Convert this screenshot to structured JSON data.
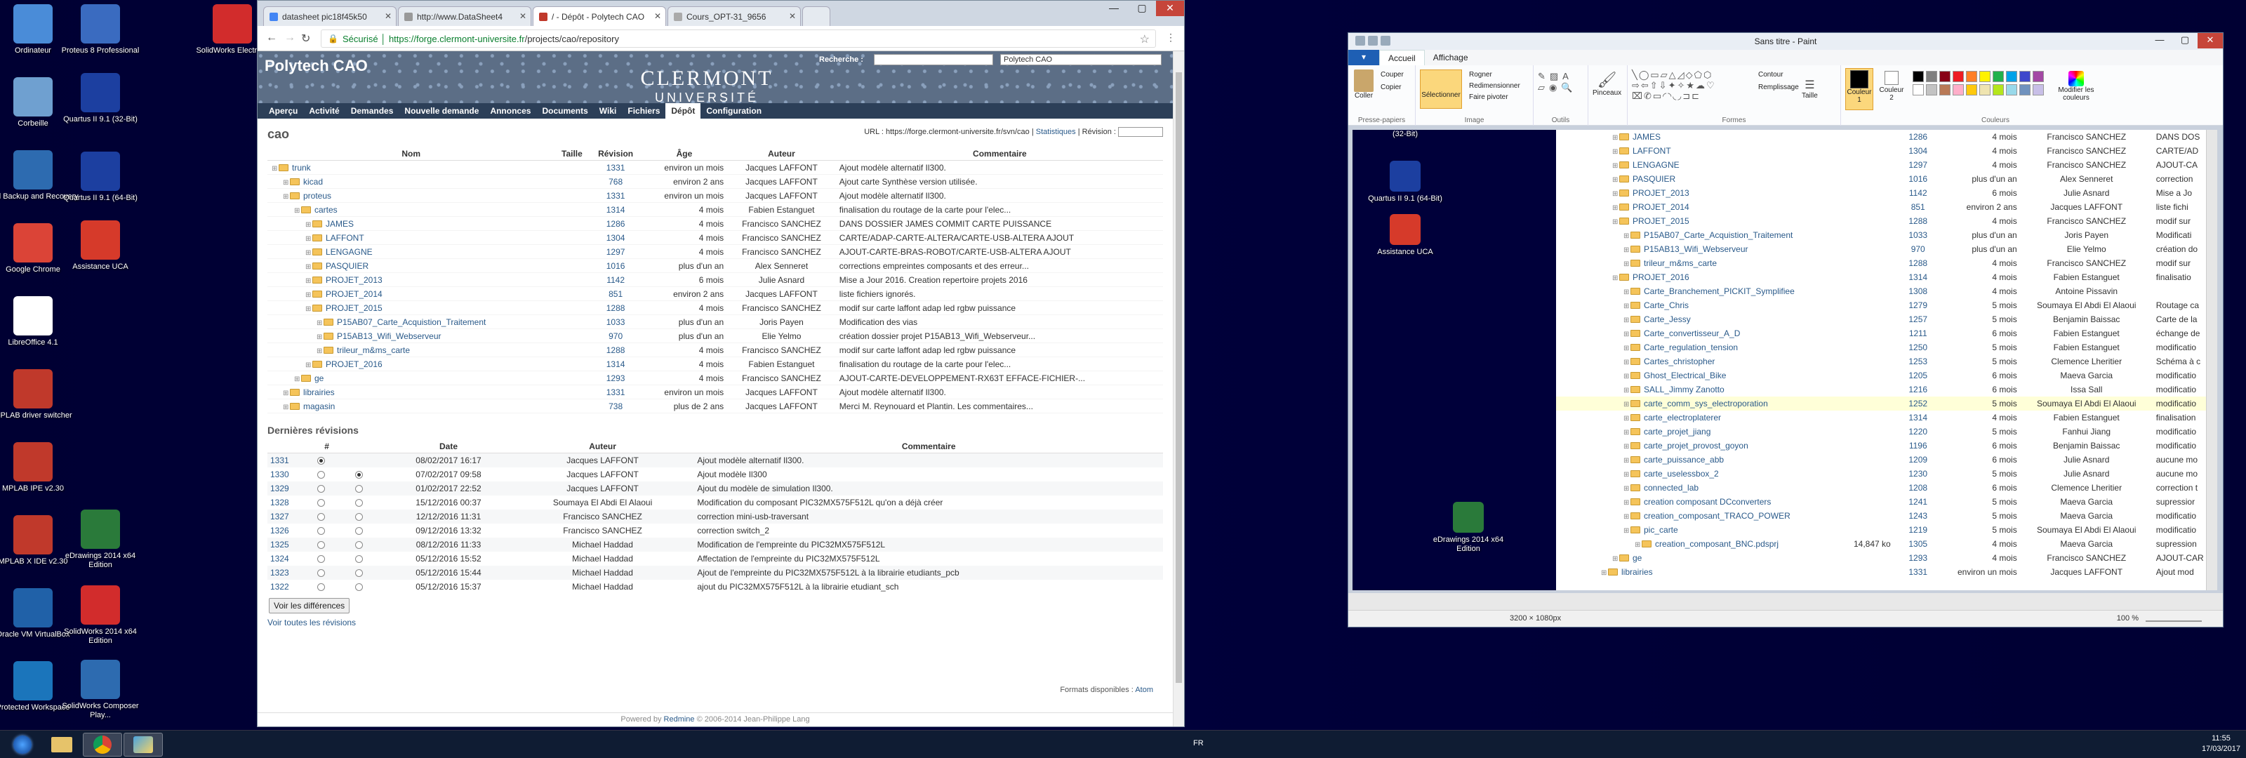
{
  "desktop": {
    "icons_left": [
      {
        "label": "Ordinateur",
        "color": "#4a8cd8"
      },
      {
        "label": "Corbeille",
        "color": "#6fa0d0"
      },
      {
        "label": "Dell Backup and Recovery",
        "color": "#2d6bb0"
      },
      {
        "label": "Google Chrome",
        "color": "#db4437"
      },
      {
        "label": "LibreOffice 4.1",
        "color": "#ffffff"
      },
      {
        "label": "MPLAB driver switcher",
        "color": "#c0392b"
      },
      {
        "label": "MPLAB IPE v2.30",
        "color": "#c0392b"
      },
      {
        "label": "MPLAB X IDE v2.30",
        "color": "#c0392b"
      },
      {
        "label": "Oracle VM VirtualBox",
        "color": "#2061a8"
      },
      {
        "label": "Protected Workspace",
        "color": "#1b75bb"
      }
    ],
    "icons_col2": [
      {
        "label": "Proteus 8 Professional",
        "color": "#3a6bc0"
      },
      {
        "label": "Quartus II 9.1 (32-Bit)",
        "color": "#1c3fa0"
      },
      {
        "label": "Quartus II 9.1 (64-Bit)",
        "color": "#1c3fa0"
      },
      {
        "label": "Assistance UCA",
        "color": "#d63a2a"
      },
      {
        "label": "eDrawings 2014 x64 Edition",
        "color": "#2a7a3a"
      },
      {
        "label": "SolidWorks 2014 x64 Edition",
        "color": "#d22c2c"
      },
      {
        "label": "SolidWorks Composer Play...",
        "color": "#2d6bb0"
      }
    ],
    "icons_col3": [
      {
        "label": "SolidWorks Electrical",
        "color": "#d22c2c"
      }
    ]
  },
  "browser": {
    "tabs": [
      {
        "label": "datasheet pic18f45k50"
      },
      {
        "label": "http://www.DataSheet4"
      },
      {
        "label": "/ - Dépôt - Polytech CAO"
      },
      {
        "label": "Cours_OPT-31_9656"
      }
    ],
    "url_secure": "Sécurisé",
    "url_host": "https://forge.clermont-universite.fr",
    "url_path": "/projects/cao/repository"
  },
  "redmine": {
    "project_title": "Polytech CAO",
    "search_label": "Recherche :",
    "project_select": "Polytech CAO",
    "logo_line1": "CLERMONT",
    "logo_line2": "UNIVERSITÉ",
    "menu": [
      "Aperçu",
      "Activité",
      "Demandes",
      "Nouvelle demande",
      "Annonces",
      "Documents",
      "Wiki",
      "Fichiers",
      "Dépôt",
      "Configuration"
    ],
    "heading": "cao",
    "url_label": "URL : https://forge.clermont-universite.fr/svn/cao",
    "stats_link": "Statistiques",
    "revision_label": "Révision :",
    "repo_headers": [
      "Nom",
      "Taille",
      "Révision",
      "Âge",
      "Auteur",
      "Commentaire"
    ],
    "repo_rows": [
      {
        "name": "trunk",
        "rev": "1331",
        "age": "environ un mois",
        "author": "Jacques LAFFONT",
        "comment": "Ajout modèle alternatif Il300."
      },
      {
        "name": "kicad",
        "rev": "768",
        "age": "environ 2 ans",
        "author": "Jacques LAFFONT",
        "comment": "Ajout carte Synthèse version utilisée."
      },
      {
        "name": "proteus",
        "rev": "1331",
        "age": "environ un mois",
        "author": "Jacques LAFFONT",
        "comment": "Ajout modèle alternatif Il300."
      },
      {
        "name": "cartes",
        "rev": "1314",
        "age": "4 mois",
        "author": "Fabien Estanguet",
        "comment": "finalisation du routage de la carte pour l'elec..."
      },
      {
        "name": "JAMES",
        "rev": "1286",
        "age": "4 mois",
        "author": "Francisco SANCHEZ",
        "comment": "DANS DOSSIER JAMES COMMIT CARTE PUISSANCE"
      },
      {
        "name": "LAFFONT",
        "rev": "1304",
        "age": "4 mois",
        "author": "Francisco SANCHEZ",
        "comment": "CARTE/ADAP-CARTE-ALTERA/CARTE-USB-ALTERA AJOUT"
      },
      {
        "name": "LENGAGNE",
        "rev": "1297",
        "age": "4 mois",
        "author": "Francisco SANCHEZ",
        "comment": "AJOUT-CARTE-BRAS-ROBOT/CARTE-USB-ALTERA AJOUT"
      },
      {
        "name": "PASQUIER",
        "rev": "1016",
        "age": "plus d'un an",
        "author": "Alex Senneret",
        "comment": "corrections empreintes composants et des erreur..."
      },
      {
        "name": "PROJET_2013",
        "rev": "1142",
        "age": "6 mois",
        "author": "Julie Asnard",
        "comment": "Mise a Jour 2016. Creation repertoire projets 2016"
      },
      {
        "name": "PROJET_2014",
        "rev": "851",
        "age": "environ 2 ans",
        "author": "Jacques LAFFONT",
        "comment": "liste fichiers ignorés."
      },
      {
        "name": "PROJET_2015",
        "rev": "1288",
        "age": "4 mois",
        "author": "Francisco SANCHEZ",
        "comment": "modif sur carte laffont adap led rgbw puissance"
      },
      {
        "name": "P15AB07_Carte_Acquistion_Traitement",
        "rev": "1033",
        "age": "plus d'un an",
        "author": "Joris Payen",
        "comment": "Modification des vias"
      },
      {
        "name": "P15AB13_Wifi_Webserveur",
        "rev": "970",
        "age": "plus d'un an",
        "author": "Elie Yelmo",
        "comment": "création dossier projet P15AB13_Wifi_Webserveur..."
      },
      {
        "name": "trileur_m&ms_carte",
        "rev": "1288",
        "age": "4 mois",
        "author": "Francisco SANCHEZ",
        "comment": "modif sur carte laffont adap led rgbw puissance"
      },
      {
        "name": "PROJET_2016",
        "rev": "1314",
        "age": "4 mois",
        "author": "Fabien Estanguet",
        "comment": "finalisation du routage de la carte pour l'elec..."
      },
      {
        "name": "ge",
        "rev": "1293",
        "age": "4 mois",
        "author": "Francisco SANCHEZ",
        "comment": "AJOUT-CARTE-DEVELOPPEMENT-RX63T EFFACE-FICHIER-..."
      },
      {
        "name": "librairies",
        "rev": "1331",
        "age": "environ un mois",
        "author": "Jacques LAFFONT",
        "comment": "Ajout modèle alternatif Il300."
      },
      {
        "name": "magasin",
        "rev": "738",
        "age": "plus de 2 ans",
        "author": "Jacques LAFFONT",
        "comment": "Merci M. Reynouard et Plantin. Les commentaires..."
      }
    ],
    "revisions_title": "Dernières révisions",
    "rev_headers": [
      "#",
      "Date",
      "Auteur",
      "Commentaire"
    ],
    "revisions": [
      {
        "id": "1331",
        "date": "08/02/2017 16:17",
        "author": "Jacques LAFFONT",
        "comment": "Ajout modèle alternatif Il300."
      },
      {
        "id": "1330",
        "date": "07/02/2017 09:58",
        "author": "Jacques LAFFONT",
        "comment": "Ajout modèle Il300"
      },
      {
        "id": "1329",
        "date": "01/02/2017 22:52",
        "author": "Jacques LAFFONT",
        "comment": "Ajout du modèle de simulation Il300."
      },
      {
        "id": "1328",
        "date": "15/12/2016 00:37",
        "author": "Soumaya El Abdi El Alaoui",
        "comment": "Modification du composant PIC32MX575F512L qu'on a déjà créer"
      },
      {
        "id": "1327",
        "date": "12/12/2016 11:31",
        "author": "Francisco SANCHEZ",
        "comment": "correction mini-usb-traversant"
      },
      {
        "id": "1326",
        "date": "09/12/2016 13:32",
        "author": "Francisco SANCHEZ",
        "comment": "correction switch_2"
      },
      {
        "id": "1325",
        "date": "08/12/2016 11:33",
        "author": "Michael Haddad",
        "comment": "Modification de l'empreinte du PIC32MX575F512L"
      },
      {
        "id": "1324",
        "date": "05/12/2016 15:52",
        "author": "Michael Haddad",
        "comment": "Affectation de l'empreinte du PIC32MX575F512L"
      },
      {
        "id": "1323",
        "date": "05/12/2016 15:44",
        "author": "Michael Haddad",
        "comment": "Ajout de l'empreinte du PIC32MX575F512L à la librairie etudiants_pcb"
      },
      {
        "id": "1322",
        "date": "05/12/2016 15:37",
        "author": "Michael Haddad",
        "comment": "ajout du PIC32MX575F512L à la librairie etudiant_sch"
      }
    ],
    "diff_button": "Voir les différences",
    "all_revisions_link": "Voir toutes les révisions",
    "formats_label": "Formats disponibles :",
    "formats_atom": "Atom",
    "footer_text": "Powered by",
    "footer_link": "Redmine",
    "footer_copy": "© 2006-2014 Jean-Philippe Lang"
  },
  "paint": {
    "title": "Sans titre - Paint",
    "tabs": [
      "Accueil",
      "Affichage"
    ],
    "groups": [
      "Presse-papiers",
      "Image",
      "Outils",
      "Formes",
      "Couleurs"
    ],
    "clipboard": {
      "paste": "Coller",
      "cut": "Couper",
      "copy": "Copier"
    },
    "image": {
      "select": "Sélectionner",
      "crop": "Rogner",
      "resize": "Redimensionner",
      "rotate": "Faire pivoter"
    },
    "brushes": "Pinceaux",
    "outline": "Contour",
    "fill": "Remplissage",
    "size": "Taille",
    "color1": "Couleur 1",
    "color2": "Couleur 2",
    "edit_colors": "Modifier les couleurs",
    "palette": [
      "#000000",
      "#7f7f7f",
      "#880015",
      "#ed1c24",
      "#ff7f27",
      "#fff200",
      "#22b14c",
      "#00a2e8",
      "#3f48cc",
      "#a349a4",
      "#ffffff",
      "#c3c3c3",
      "#b97a57",
      "#ffaec9",
      "#ffc90e",
      "#efe4b0",
      "#b5e61d",
      "#99d9ea",
      "#7092be",
      "#c8bfe7"
    ],
    "canvas_icons": [
      {
        "label": "(32-Bit)"
      },
      {
        "label": "Quartus II 9.1 (64-Bit)"
      },
      {
        "label": "Assistance UCA"
      },
      {
        "label": "eDrawings 2014 x64 Edition"
      }
    ],
    "canvas_rows": [
      {
        "name": "JAMES",
        "rev": "1286",
        "age": "4 mois",
        "author": "Francisco SANCHEZ",
        "comment": "DANS DOS"
      },
      {
        "name": "LAFFONT",
        "rev": "1304",
        "age": "4 mois",
        "author": "Francisco SANCHEZ",
        "comment": "CARTE/AD"
      },
      {
        "name": "LENGAGNE",
        "rev": "1297",
        "age": "4 mois",
        "author": "Francisco SANCHEZ",
        "comment": "AJOUT-CA"
      },
      {
        "name": "PASQUIER",
        "rev": "1016",
        "age": "plus d'un an",
        "author": "Alex Senneret",
        "comment": "correction"
      },
      {
        "name": "PROJET_2013",
        "rev": "1142",
        "age": "6 mois",
        "author": "Julie Asnard",
        "comment": "Mise a Jo"
      },
      {
        "name": "PROJET_2014",
        "rev": "851",
        "age": "environ 2 ans",
        "author": "Jacques LAFFONT",
        "comment": "liste fichi"
      },
      {
        "name": "PROJET_2015",
        "rev": "1288",
        "age": "4 mois",
        "author": "Francisco SANCHEZ",
        "comment": "modif sur"
      },
      {
        "name": "P15AB07_Carte_Acquistion_Traitement",
        "rev": "1033",
        "age": "plus d'un an",
        "author": "Joris Payen",
        "comment": "Modificati"
      },
      {
        "name": "P15AB13_Wifi_Webserveur",
        "rev": "970",
        "age": "plus d'un an",
        "author": "Elie Yelmo",
        "comment": "création do"
      },
      {
        "name": "trileur_m&ms_carte",
        "rev": "1288",
        "age": "4 mois",
        "author": "Francisco SANCHEZ",
        "comment": "modif sur"
      },
      {
        "name": "PROJET_2016",
        "rev": "1314",
        "age": "4 mois",
        "author": "Fabien Estanguet",
        "comment": "finalisatio"
      },
      {
        "name": "Carte_Branchement_PICKIT_Symplifiee",
        "rev": "1308",
        "age": "4 mois",
        "author": "Antoine Pissavin",
        "comment": ""
      },
      {
        "name": "Carte_Chris",
        "rev": "1279",
        "age": "5 mois",
        "author": "Soumaya El Abdi El Alaoui",
        "comment": "Routage ca"
      },
      {
        "name": "Carte_Jessy",
        "rev": "1257",
        "age": "5 mois",
        "author": "Benjamin Baissac",
        "comment": "Carte de la"
      },
      {
        "name": "Carte_convertisseur_A_D",
        "rev": "1211",
        "age": "6 mois",
        "author": "Fabien Estanguet",
        "comment": "échange de"
      },
      {
        "name": "Carte_regulation_tension",
        "rev": "1250",
        "age": "5 mois",
        "author": "Fabien Estanguet",
        "comment": "modificatio"
      },
      {
        "name": "Cartes_christopher",
        "rev": "1253",
        "age": "5 mois",
        "author": "Clemence Lheritier",
        "comment": "Schéma à c"
      },
      {
        "name": "Ghost_Electrical_Bike",
        "rev": "1205",
        "age": "6 mois",
        "author": "Maeva Garcia",
        "comment": "modificatio"
      },
      {
        "name": "SALL_Jimmy Zanotto",
        "rev": "1216",
        "age": "6 mois",
        "author": "Issa Sall",
        "comment": "modificatio"
      },
      {
        "name": "carte_comm_sys_electroporation",
        "rev": "1252",
        "age": "5 mois",
        "author": "Soumaya El Abdi El Alaoui",
        "comment": "modificatio"
      },
      {
        "name": "carte_electroplaterer",
        "rev": "1314",
        "age": "4 mois",
        "author": "Fabien Estanguet",
        "comment": "finalisation"
      },
      {
        "name": "carte_projet_jiang",
        "rev": "1220",
        "age": "5 mois",
        "author": "Fanhui Jiang",
        "comment": "modificatio"
      },
      {
        "name": "carte_projet_provost_goyon",
        "rev": "1196",
        "age": "6 mois",
        "author": "Benjamin Baissac",
        "comment": "modificatio"
      },
      {
        "name": "carte_puissance_abb",
        "rev": "1209",
        "age": "6 mois",
        "author": "Julie Asnard",
        "comment": "aucune mo"
      },
      {
        "name": "carte_uselessbox_2",
        "rev": "1230",
        "age": "5 mois",
        "author": "Julie Asnard",
        "comment": "aucune mo"
      },
      {
        "name": "connected_lab",
        "rev": "1208",
        "age": "6 mois",
        "author": "Clemence Lheritier",
        "comment": "correction t"
      },
      {
        "name": "creation composant DCconverters",
        "rev": "1241",
        "age": "5 mois",
        "author": "Maeva Garcia",
        "comment": "supressior"
      },
      {
        "name": "creation_composant_TRACO_POWER",
        "rev": "1243",
        "age": "5 mois",
        "author": "Maeva Garcia",
        "comment": "modificatio"
      },
      {
        "name": "pic_carte",
        "rev": "1219",
        "age": "5 mois",
        "author": "Soumaya El Abdi El Alaoui",
        "comment": "modificatio"
      },
      {
        "name": "creation_composant_BNC.pdsprj",
        "size": "14,847 ko",
        "rev": "1305",
        "age": "4 mois",
        "author": "Maeva Garcia",
        "comment": "supression"
      },
      {
        "name": "ge",
        "rev": "1293",
        "age": "4 mois",
        "author": "Francisco SANCHEZ",
        "comment": "AJOUT-CAR"
      },
      {
        "name": "librairies",
        "rev": "1331",
        "age": "environ un mois",
        "author": "Jacques LAFFONT",
        "comment": "Ajout mod"
      }
    ],
    "status_size": "3200 × 1080px",
    "zoom": "100 %"
  },
  "taskbar": {
    "lang": "FR",
    "time": "11:55",
    "date": "17/03/2017"
  }
}
